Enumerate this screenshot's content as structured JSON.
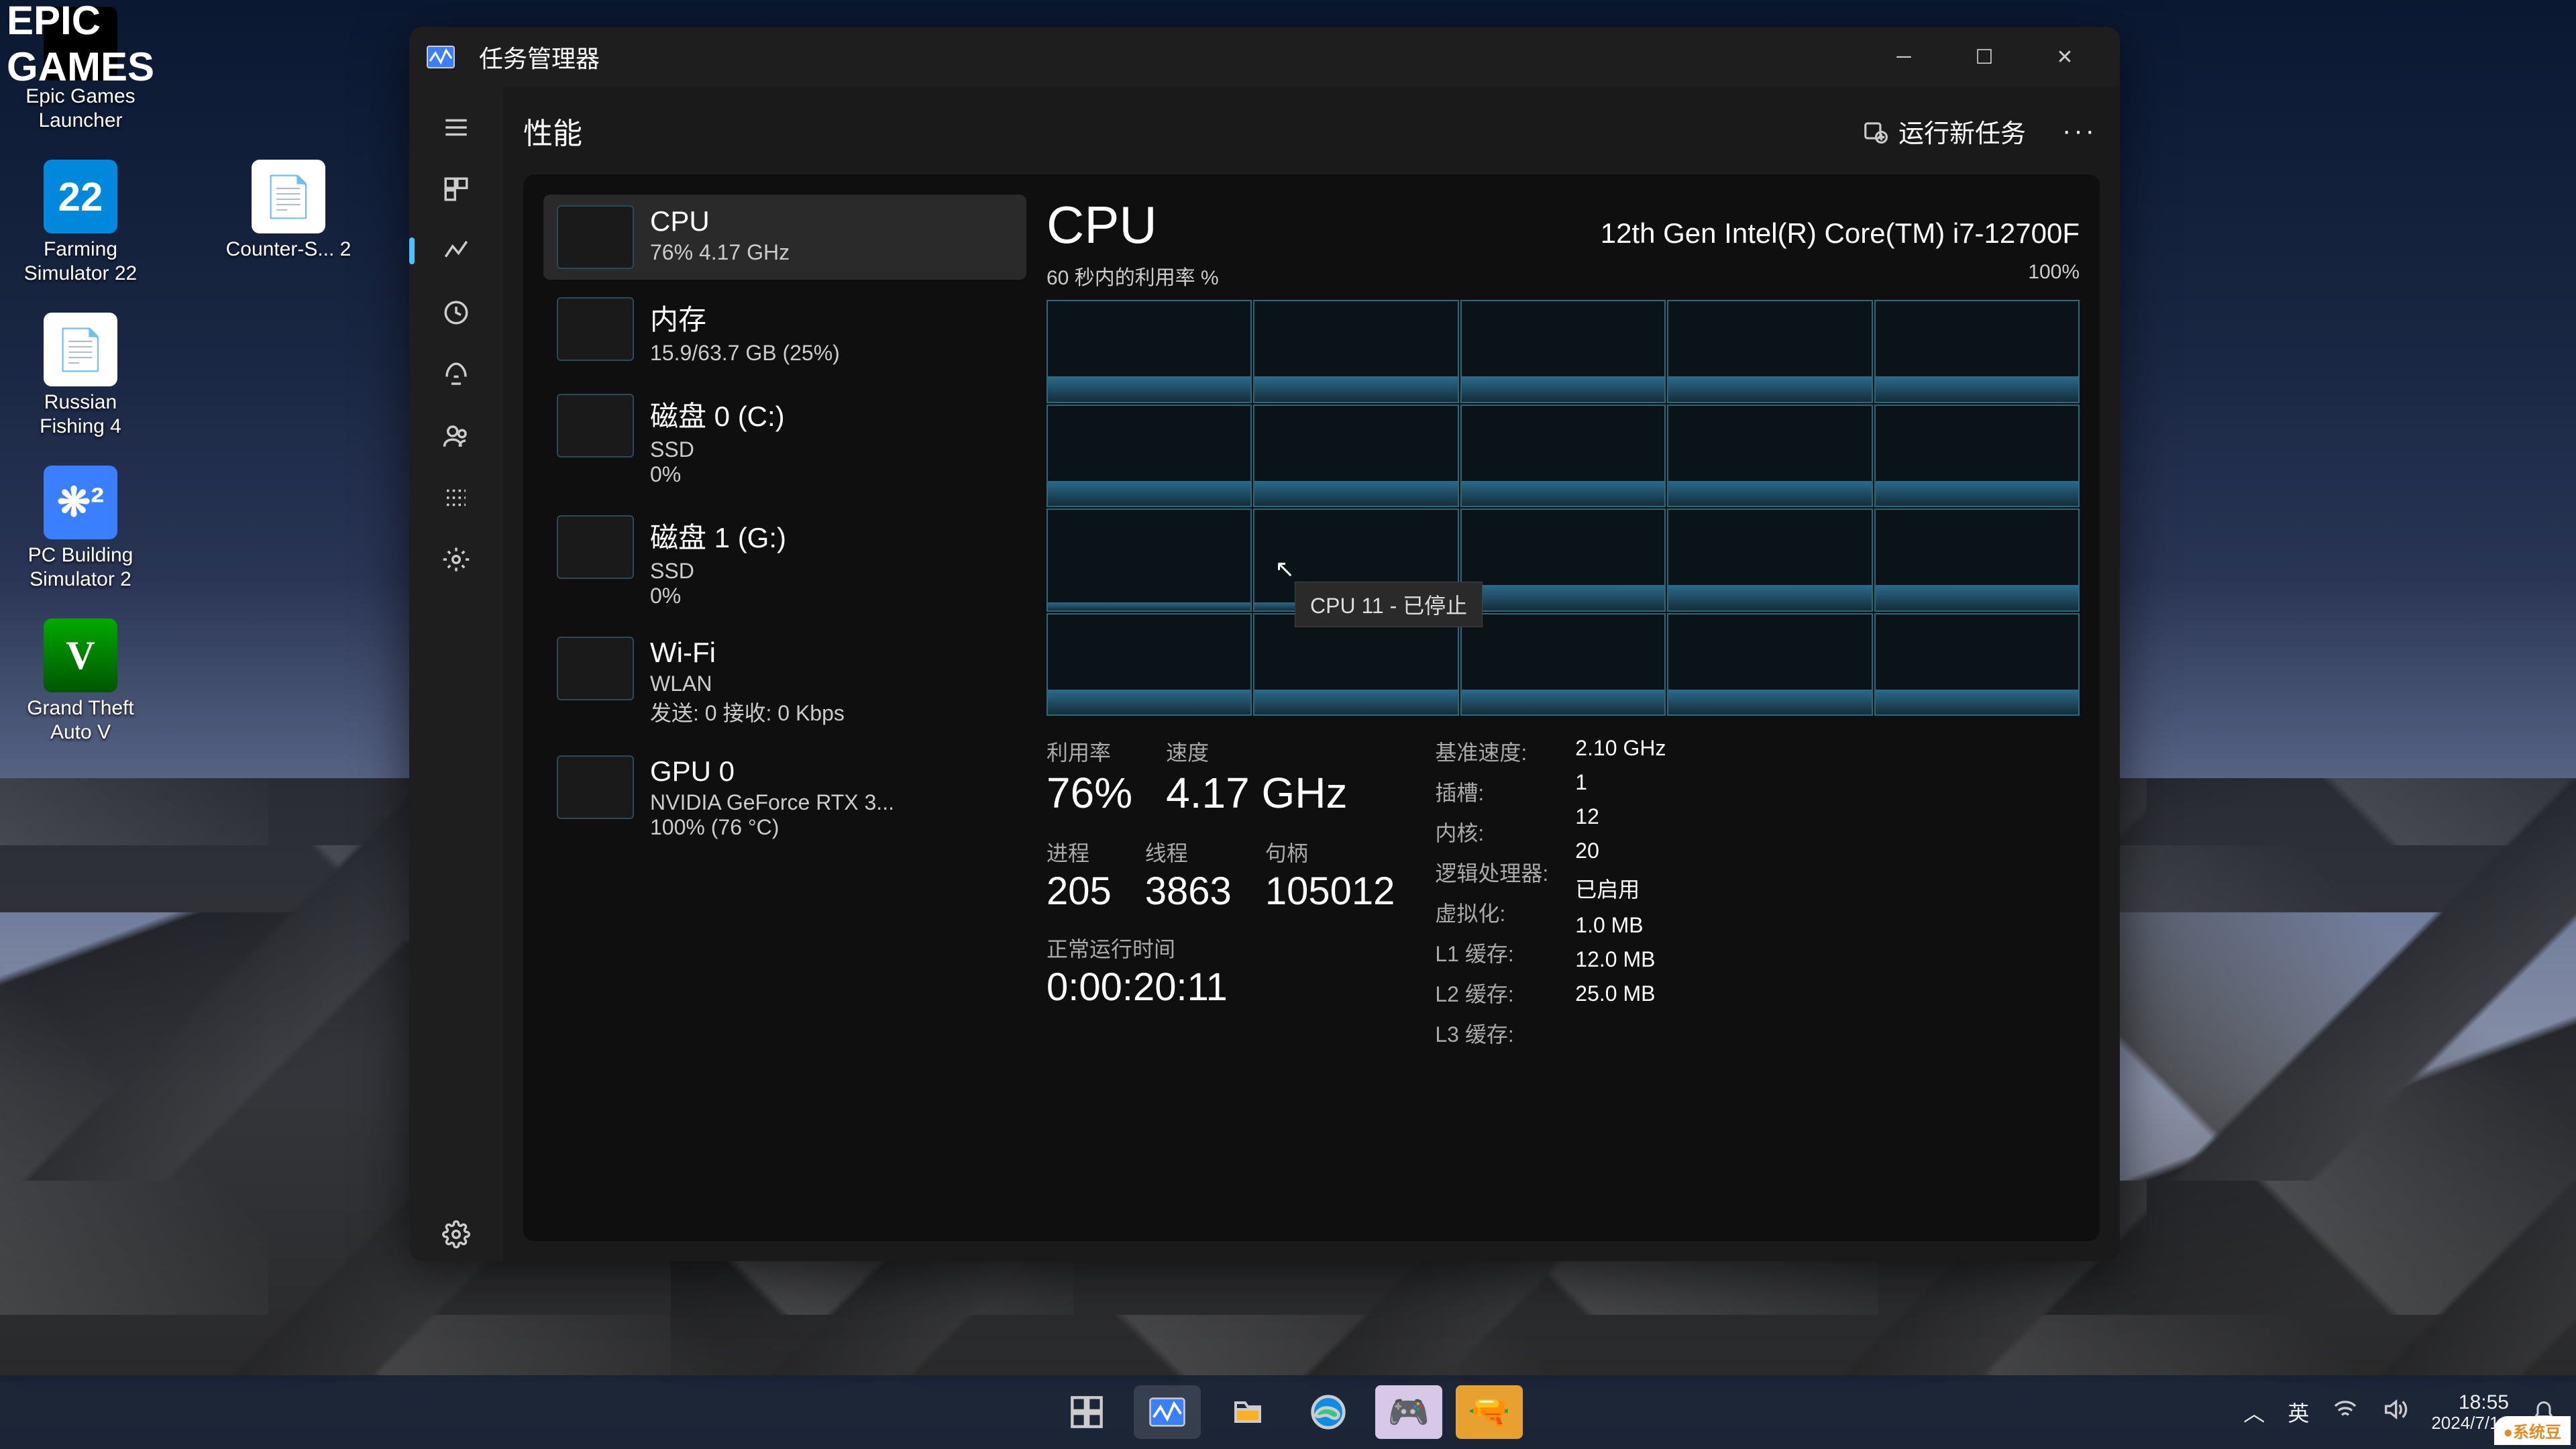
{
  "desktop": {
    "icons": [
      {
        "label": "Epic Games Launcher",
        "kind": "epic",
        "text": "EPIC\nGAMES"
      },
      {
        "label": "Farming Simulator 22",
        "kind": "fs22",
        "text": "22"
      },
      {
        "label": "Counter-S... 2",
        "kind": "file",
        "text": ""
      },
      {
        "label": "Russian Fishing 4",
        "kind": "file",
        "text": ""
      },
      {
        "label": "PC Building Simulator 2",
        "kind": "pcbs",
        "text": "❋²"
      },
      {
        "label": "Grand Theft Auto V",
        "kind": "gtav",
        "text": "V"
      }
    ]
  },
  "tm": {
    "title": "任务管理器",
    "header": {
      "tab": "性能",
      "run_task": "运行新任务"
    },
    "sidebar_tips": [
      "menu",
      "processes",
      "performance",
      "history",
      "startup",
      "users",
      "details",
      "services",
      "settings"
    ],
    "perf_list": [
      {
        "title": "CPU",
        "sub": "76%  4.17 GHz",
        "sub2": ""
      },
      {
        "title": "内存",
        "sub": "15.9/63.7 GB (25%)",
        "sub2": ""
      },
      {
        "title": "磁盘 0 (C:)",
        "sub": "SSD",
        "sub2": "0%"
      },
      {
        "title": "磁盘 1 (G:)",
        "sub": "SSD",
        "sub2": "0%"
      },
      {
        "title": "Wi-Fi",
        "sub": "WLAN",
        "sub2": "发送: 0  接收: 0 Kbps"
      },
      {
        "title": "GPU 0",
        "sub": "NVIDIA GeForce RTX 3...",
        "sub2": "100% (76 °C)"
      }
    ],
    "detail": {
      "name": "CPU",
      "model": "12th Gen Intel(R) Core(TM) i7-12700F",
      "graph_label": "60 秒内的利用率 %",
      "graph_max": "100%",
      "tooltip": "CPU 11 - 已停止",
      "stats": {
        "util_label": "利用率",
        "util": "76%",
        "speed_label": "速度",
        "speed": "4.17 GHz",
        "proc_label": "进程",
        "proc": "205",
        "thread_label": "线程",
        "thread": "3863",
        "handle_label": "句柄",
        "handle": "105012",
        "uptime_label": "正常运行时间",
        "uptime": "0:00:20:11"
      },
      "info_keys": [
        "基准速度:",
        "插槽:",
        "内核:",
        "逻辑处理器:",
        "虚拟化:",
        "L1 缓存:",
        "L2 缓存:",
        "L3 缓存:"
      ],
      "info_vals": [
        "2.10 GHz",
        "1",
        "12",
        "20",
        "已启用",
        "1.0 MB",
        "12.0 MB",
        "25.0 MB"
      ]
    }
  },
  "taskbar": {
    "ime": "英",
    "time": "18:55",
    "date": "2024/7/14",
    "watermark": "系统豆"
  }
}
